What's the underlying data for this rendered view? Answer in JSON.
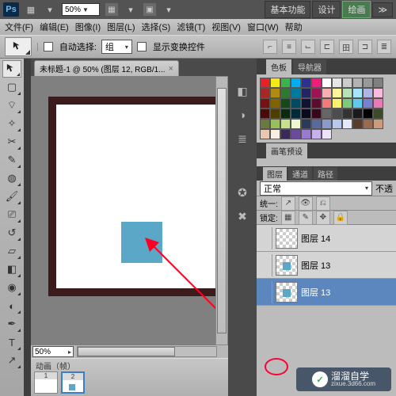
{
  "title_zoom": "50%",
  "modes": {
    "basic": "基本功能",
    "design": "设计",
    "draw": "绘画"
  },
  "menu": {
    "file": "文件(F)",
    "edit": "编辑(E)",
    "image": "图像(I)",
    "layer": "图层(L)",
    "select": "选择(S)",
    "filter": "滤镜(T)",
    "view": "视图(V)",
    "window": "窗口(W)",
    "help": "帮助"
  },
  "opt": {
    "auto_label": "自动选择:",
    "auto_val": "组",
    "show_transform": "显示变换控件"
  },
  "doc": {
    "title": "未标题-1 @ 50% (图层 12, RGB/1..."
  },
  "bottom_zoom": "50%",
  "anim": {
    "title": "动画（帧）",
    "f1": "1",
    "f2": "2"
  },
  "panels": {
    "swatch": "色板",
    "navigator": "导航器",
    "brush": "画笔预设",
    "layers": "图层",
    "channels": "通道",
    "paths": "路径"
  },
  "blend": {
    "mode": "正常",
    "opacity_pre": "不透"
  },
  "unify": {
    "label": "统一:"
  },
  "lock": {
    "label": "锁定:"
  },
  "layers_list": {
    "l14": "图层 14",
    "l13a": "图层 13",
    "l13b": "图层 13"
  },
  "watermark": {
    "text": "溜溜自学",
    "url": "zixue.3d66.com"
  },
  "swatch_colors": [
    "#eb2027",
    "#f5ea14",
    "#3ab54a",
    "#00adee",
    "#2e3192",
    "#ed1e79",
    "#ffffff",
    "#e6e6e6",
    "#cccccc",
    "#b3b3b3",
    "#999999",
    "#808080",
    "#ab2524",
    "#b08b12",
    "#2d7a33",
    "#007a9e",
    "#232466",
    "#9e1453",
    "#f7b0b0",
    "#fef59a",
    "#b6e3b6",
    "#a5e4fb",
    "#b0b3e6",
    "#f7bbdc",
    "#7a1010",
    "#7e6500",
    "#144a18",
    "#004a63",
    "#121237",
    "#5e0b30",
    "#f47a7a",
    "#fdf06a",
    "#7acc7a",
    "#5fc9ee",
    "#7a80d6",
    "#e87ab6",
    "#4a0a0a",
    "#4d3f00",
    "#0a2b0d",
    "#002a38",
    "#0a0a1f",
    "#38061c",
    "#666666",
    "#4d4d4d",
    "#333333",
    "#1a1a1a",
    "#000000",
    "#3a4a2a",
    "#6a7a3a",
    "#9abf5a",
    "#c7e38a",
    "#eef7d0",
    "#2a3a5a",
    "#5a6a9a",
    "#8a9acf",
    "#bac7ec",
    "#e3e9f8",
    "#5a3a2a",
    "#9a6a4a",
    "#cf9a7a",
    "#ecc7b0",
    "#f8ece3",
    "#3a2a5a",
    "#6a4a9a",
    "#9a7acf",
    "#c7b0ec",
    "#ece3f8"
  ]
}
